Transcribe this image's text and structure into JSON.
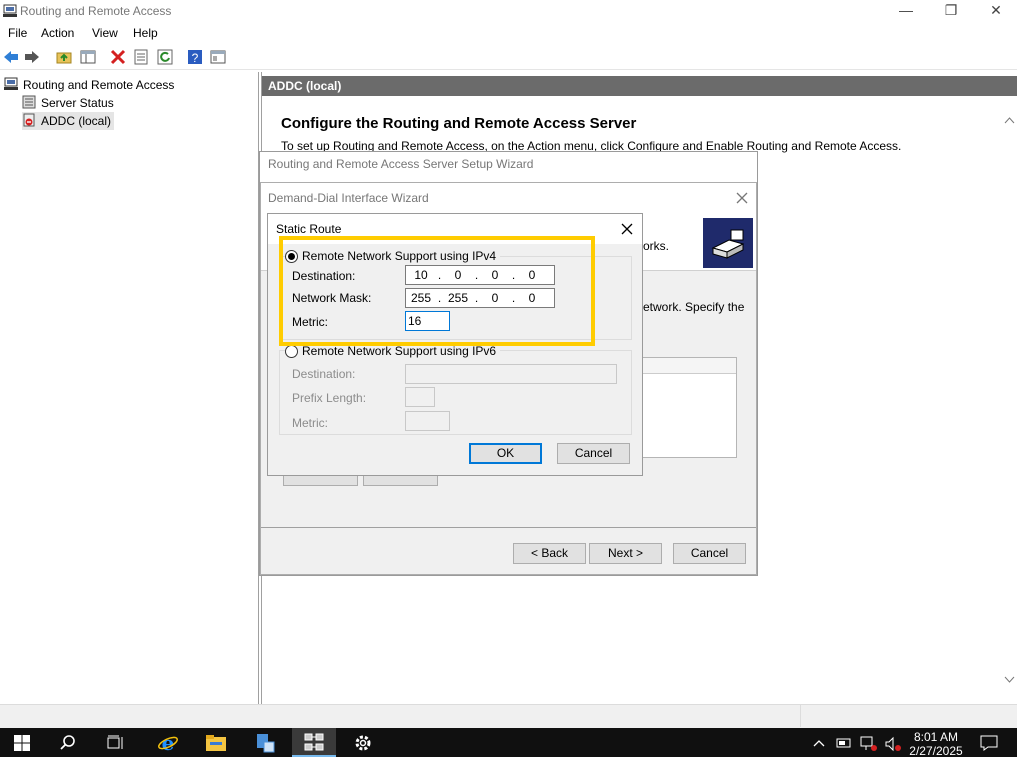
{
  "window": {
    "title": "Routing and Remote Access",
    "controls": {
      "minimize": "—",
      "restore": "❐",
      "close": "✕"
    }
  },
  "menu": [
    "File",
    "Action",
    "View",
    "Help"
  ],
  "toolbar_icons": [
    "back-arrow-icon",
    "forward-arrow-icon",
    "folder-up-icon",
    "show-hide-tree-icon",
    "delete-icon",
    "properties-icon",
    "refresh-icon",
    "help-icon",
    "console-icon"
  ],
  "tree": {
    "root": "Routing and Remote Access",
    "items": [
      "Server Status",
      "ADDC (local)"
    ]
  },
  "right_pane": {
    "header": "ADDC (local)",
    "title": "Configure the Routing and Remote Access Server",
    "subtitle": "To set up Routing and Remote Access, on the Action menu, click Configure and Enable Routing and Remote Access."
  },
  "setup_wizard": {
    "title": "Routing and Remote Access Server Setup Wizard"
  },
  "demand_dial_wizard": {
    "title": "Demand-Dial Interface Wizard",
    "header_text_fragment": "orks.",
    "body_text_fragment": "etwork. Specify the",
    "buttons": {
      "back": "< Back",
      "next": "Next >",
      "cancel": "Cancel"
    }
  },
  "static_route": {
    "title": "Static Route",
    "ipv4": {
      "label": "Remote Network Support using IPv4",
      "selected": true,
      "destination_label": "Destination:",
      "destination": [
        "10",
        "0",
        "0",
        "0"
      ],
      "mask_label": "Network Mask:",
      "mask": [
        "255",
        "255",
        "0",
        "0"
      ],
      "metric_label": "Metric:",
      "metric": "16"
    },
    "ipv6": {
      "label": "Remote Network Support using IPv6",
      "selected": false,
      "destination_label": "Destination:",
      "prefix_label": "Prefix Length:",
      "metric_label": "Metric:"
    },
    "ok": "OK",
    "cancel": "Cancel"
  },
  "taskbar": {
    "time": "8:01 AM",
    "date": "2/27/2025"
  },
  "colors": {
    "highlight": "#ffcc00",
    "header_bar": "#6b6b6b",
    "taskbar": "#101010",
    "ok_border": "#0078d7"
  }
}
